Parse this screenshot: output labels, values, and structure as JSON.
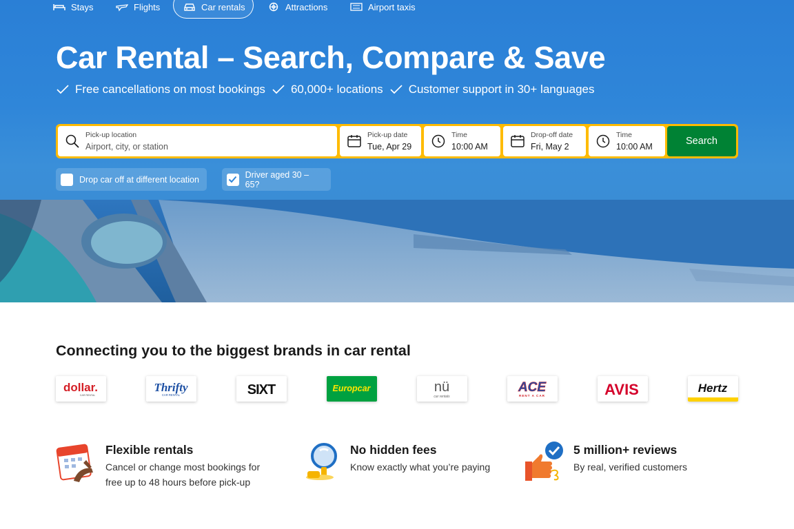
{
  "nav": {
    "items": [
      {
        "label": "Stays",
        "icon": "bed-icon"
      },
      {
        "label": "Flights",
        "icon": "plane-icon"
      },
      {
        "label": "Car rentals",
        "icon": "car-icon",
        "active": true
      },
      {
        "label": "Attractions",
        "icon": "attractions-icon"
      },
      {
        "label": "Airport taxis",
        "icon": "taxi-icon"
      }
    ]
  },
  "hero": {
    "title": "Car Rental – Search, Compare & Save",
    "perks": [
      "Free cancellations on most bookings",
      "60,000+ locations",
      "Customer support in 30+ languages"
    ]
  },
  "search": {
    "pickup_location": {
      "label": "Pick-up location",
      "placeholder": "Airport, city, or station"
    },
    "pickup_date": {
      "label": "Pick-up date",
      "value": "Tue, Apr 29"
    },
    "pickup_time": {
      "label": "Time",
      "value": "10:00 AM"
    },
    "dropoff_date": {
      "label": "Drop-off date",
      "value": "Fri, May 2"
    },
    "dropoff_time": {
      "label": "Time",
      "value": "10:00 AM"
    },
    "button": "Search",
    "options": [
      {
        "label": "Drop car off at different location",
        "checked": false
      },
      {
        "label": "Driver aged 30 – 65?",
        "checked": true
      }
    ]
  },
  "brands": {
    "title": "Connecting you to the biggest brands in car rental",
    "items": [
      {
        "name": "dollar.",
        "sub": "CAR RENTAL"
      },
      {
        "name": "Thrifty",
        "sub": "CAR RENTAL"
      },
      {
        "name": "SIXT"
      },
      {
        "name": "Europcar"
      },
      {
        "name": "nü",
        "sub": "car rentals"
      },
      {
        "name": "ACE",
        "sub": "RENT A CAR"
      },
      {
        "name": "AVIS"
      },
      {
        "name": "Hertz"
      }
    ]
  },
  "features": [
    {
      "title": "Flexible rentals",
      "desc": "Cancel or change most bookings for free up to 48 hours before pick-up",
      "icon": "calendar-hand-icon"
    },
    {
      "title": "No hidden fees",
      "desc": "Know exactly what you’re paying",
      "icon": "magnifier-icon"
    },
    {
      "title": "5 million+ reviews",
      "desc": "By real, verified customers",
      "icon": "thumbs-up-check-icon"
    }
  ],
  "colors": {
    "hero_blue": "#2f86d9",
    "search_border": "#febb02",
    "search_button": "#008234"
  }
}
